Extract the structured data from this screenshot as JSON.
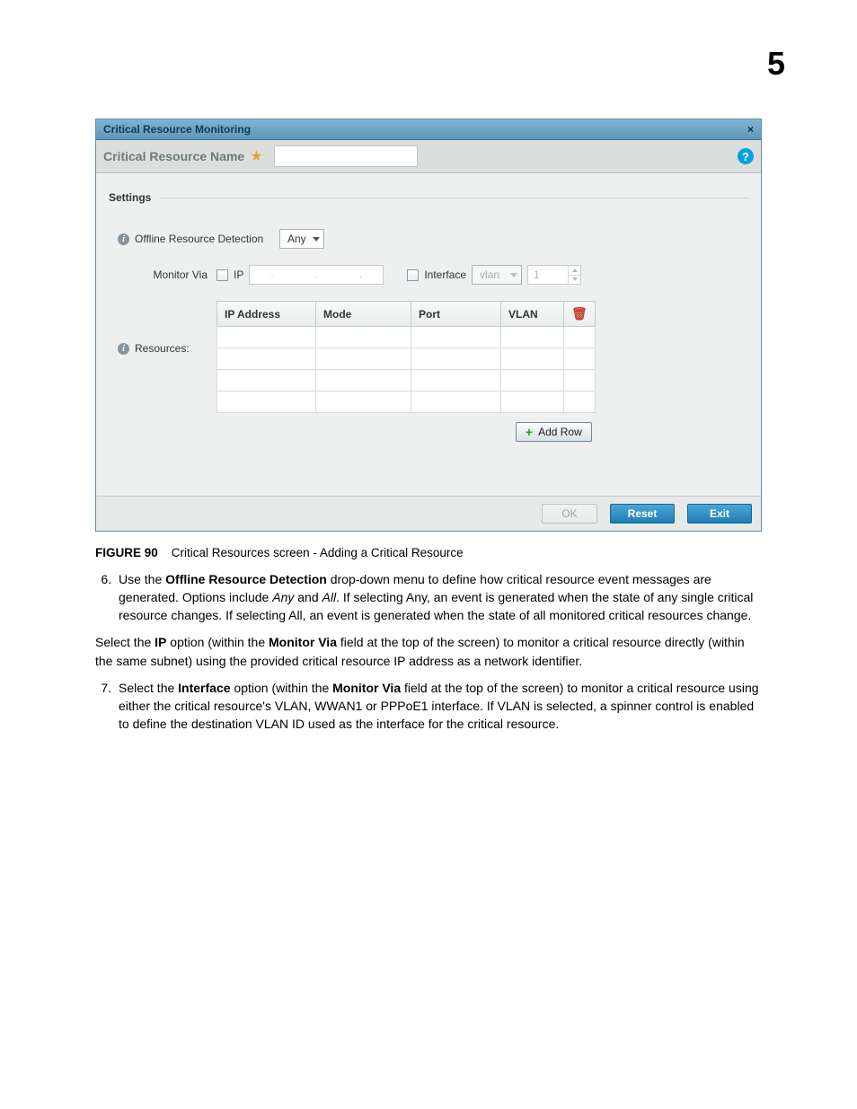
{
  "page_number": "5",
  "dialog": {
    "title": "Critical Resource Monitoring",
    "name_label": "Critical Resource Name",
    "name_value": "",
    "close": "×",
    "help": "?"
  },
  "settings": {
    "heading": "Settings",
    "offline_label": "Offline Resource Detection",
    "offline_value": "Any",
    "monitor_via_label": "Monitor Via",
    "ip_label": "IP",
    "interface_label": "Interface",
    "iface_value": "vlan",
    "vlan_id": "1",
    "resources_label": "Resources:",
    "columns": {
      "c1": "IP Address",
      "c2": "Mode",
      "c3": "Port",
      "c4": "VLAN"
    },
    "add_row": "Add Row"
  },
  "footer": {
    "ok": "OK",
    "reset": "Reset",
    "exit": "Exit"
  },
  "caption": {
    "fig": "FIGURE 90",
    "text": "Critical Resources screen - Adding a Critical Resource"
  },
  "steps": {
    "s6a": "Use the ",
    "s6b": "Offline Resource Detection",
    "s6c": " drop-down menu to define how critical resource event messages are generated. Options include ",
    "s6d": "Any",
    "s6e": " and ",
    "s6f": "All",
    "s6g": ". If selecting Any, an event is generated when the state of any single critical resource changes. If selecting All, an event is generated when the state of all monitored critical resources change.",
    "p1a": "Select the ",
    "p1b": "IP",
    "p1c": " option (within the ",
    "p1d": "Monitor Via",
    "p1e": " field at the top of the screen) to monitor a critical resource directly (within the same subnet) using the provided critical resource IP address as a network identifier.",
    "s7a": "Select the ",
    "s7b": "Interface",
    "s7c": " option (within the ",
    "s7d": "Monitor Via",
    "s7e": " field at the top of the screen) to monitor a critical resource using either the critical resource's VLAN, WWAN1 or PPPoE1 interface. If VLAN is selected, a spinner control is enabled to define the destination VLAN ID used as the interface for the critical resource."
  }
}
